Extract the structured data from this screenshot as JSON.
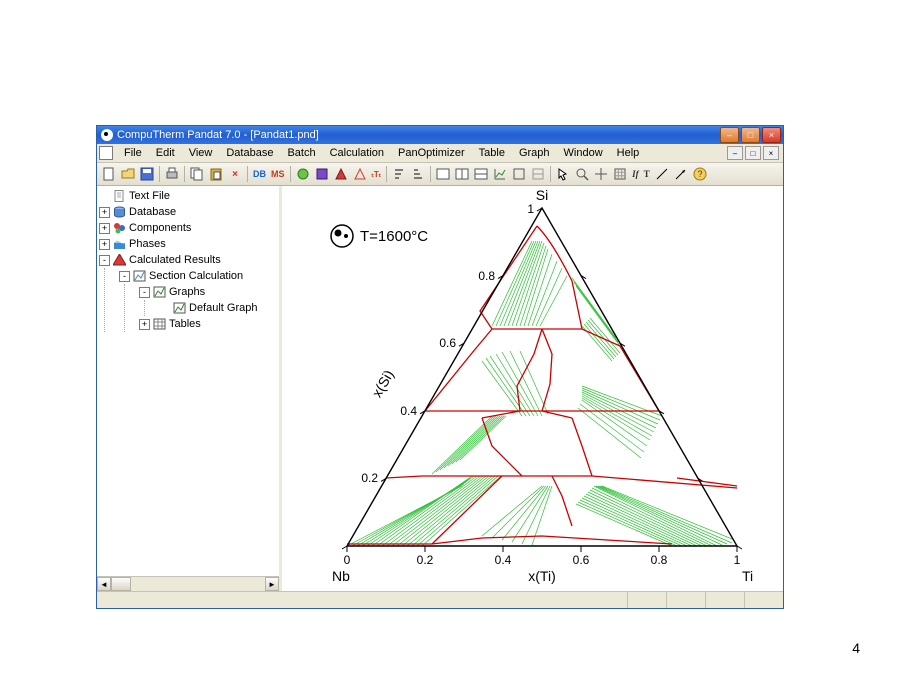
{
  "page_number": "4",
  "window": {
    "title": "CompuTherm Pandat 7.0 - [Pandat1.pnd]",
    "buttons": {
      "min": "–",
      "max": "□",
      "close": "×"
    }
  },
  "menus": [
    "File",
    "Edit",
    "View",
    "Database",
    "Batch",
    "Calculation",
    "PanOptimizer",
    "Table",
    "Graph",
    "Window",
    "Help"
  ],
  "mdi": {
    "min": "–",
    "max": "□",
    "close": "×"
  },
  "toolbar_textbuttons": {
    "db": "DB",
    "ms": "MS",
    "If": "If",
    "T": "T"
  },
  "tree": {
    "root": "Text File",
    "items": [
      {
        "label": "Database",
        "exp": "+"
      },
      {
        "label": "Components",
        "exp": "+"
      },
      {
        "label": "Phases",
        "exp": "+"
      },
      {
        "label": "Calculated Results",
        "exp": "-",
        "children": [
          {
            "label": "Section Calculation",
            "exp": "-",
            "children": [
              {
                "label": "Graphs",
                "exp": "-",
                "children": [
                  {
                    "label": "Default Graph"
                  }
                ]
              },
              {
                "label": "Tables",
                "exp": "+"
              }
            ]
          }
        ]
      }
    ]
  },
  "chart_data": {
    "type": "ternary",
    "title_annotation": "T=1600°C",
    "vertices": {
      "top": "Si",
      "left": "Nb",
      "right": "Ti"
    },
    "x_axis_label": "x(Ti)",
    "y_axis_label": "x(Si)",
    "ticks": [
      "0",
      "0.2",
      "0.4",
      "0.6",
      "0.8",
      "1"
    ],
    "phase_boundary_color": "#cc0000",
    "tieline_color": "#17b81e",
    "description": "Isothermal section of Nb–Si–Ti at 1600°C showing phase boundaries (red) and tie-lines (green) within the ternary composition triangle."
  }
}
